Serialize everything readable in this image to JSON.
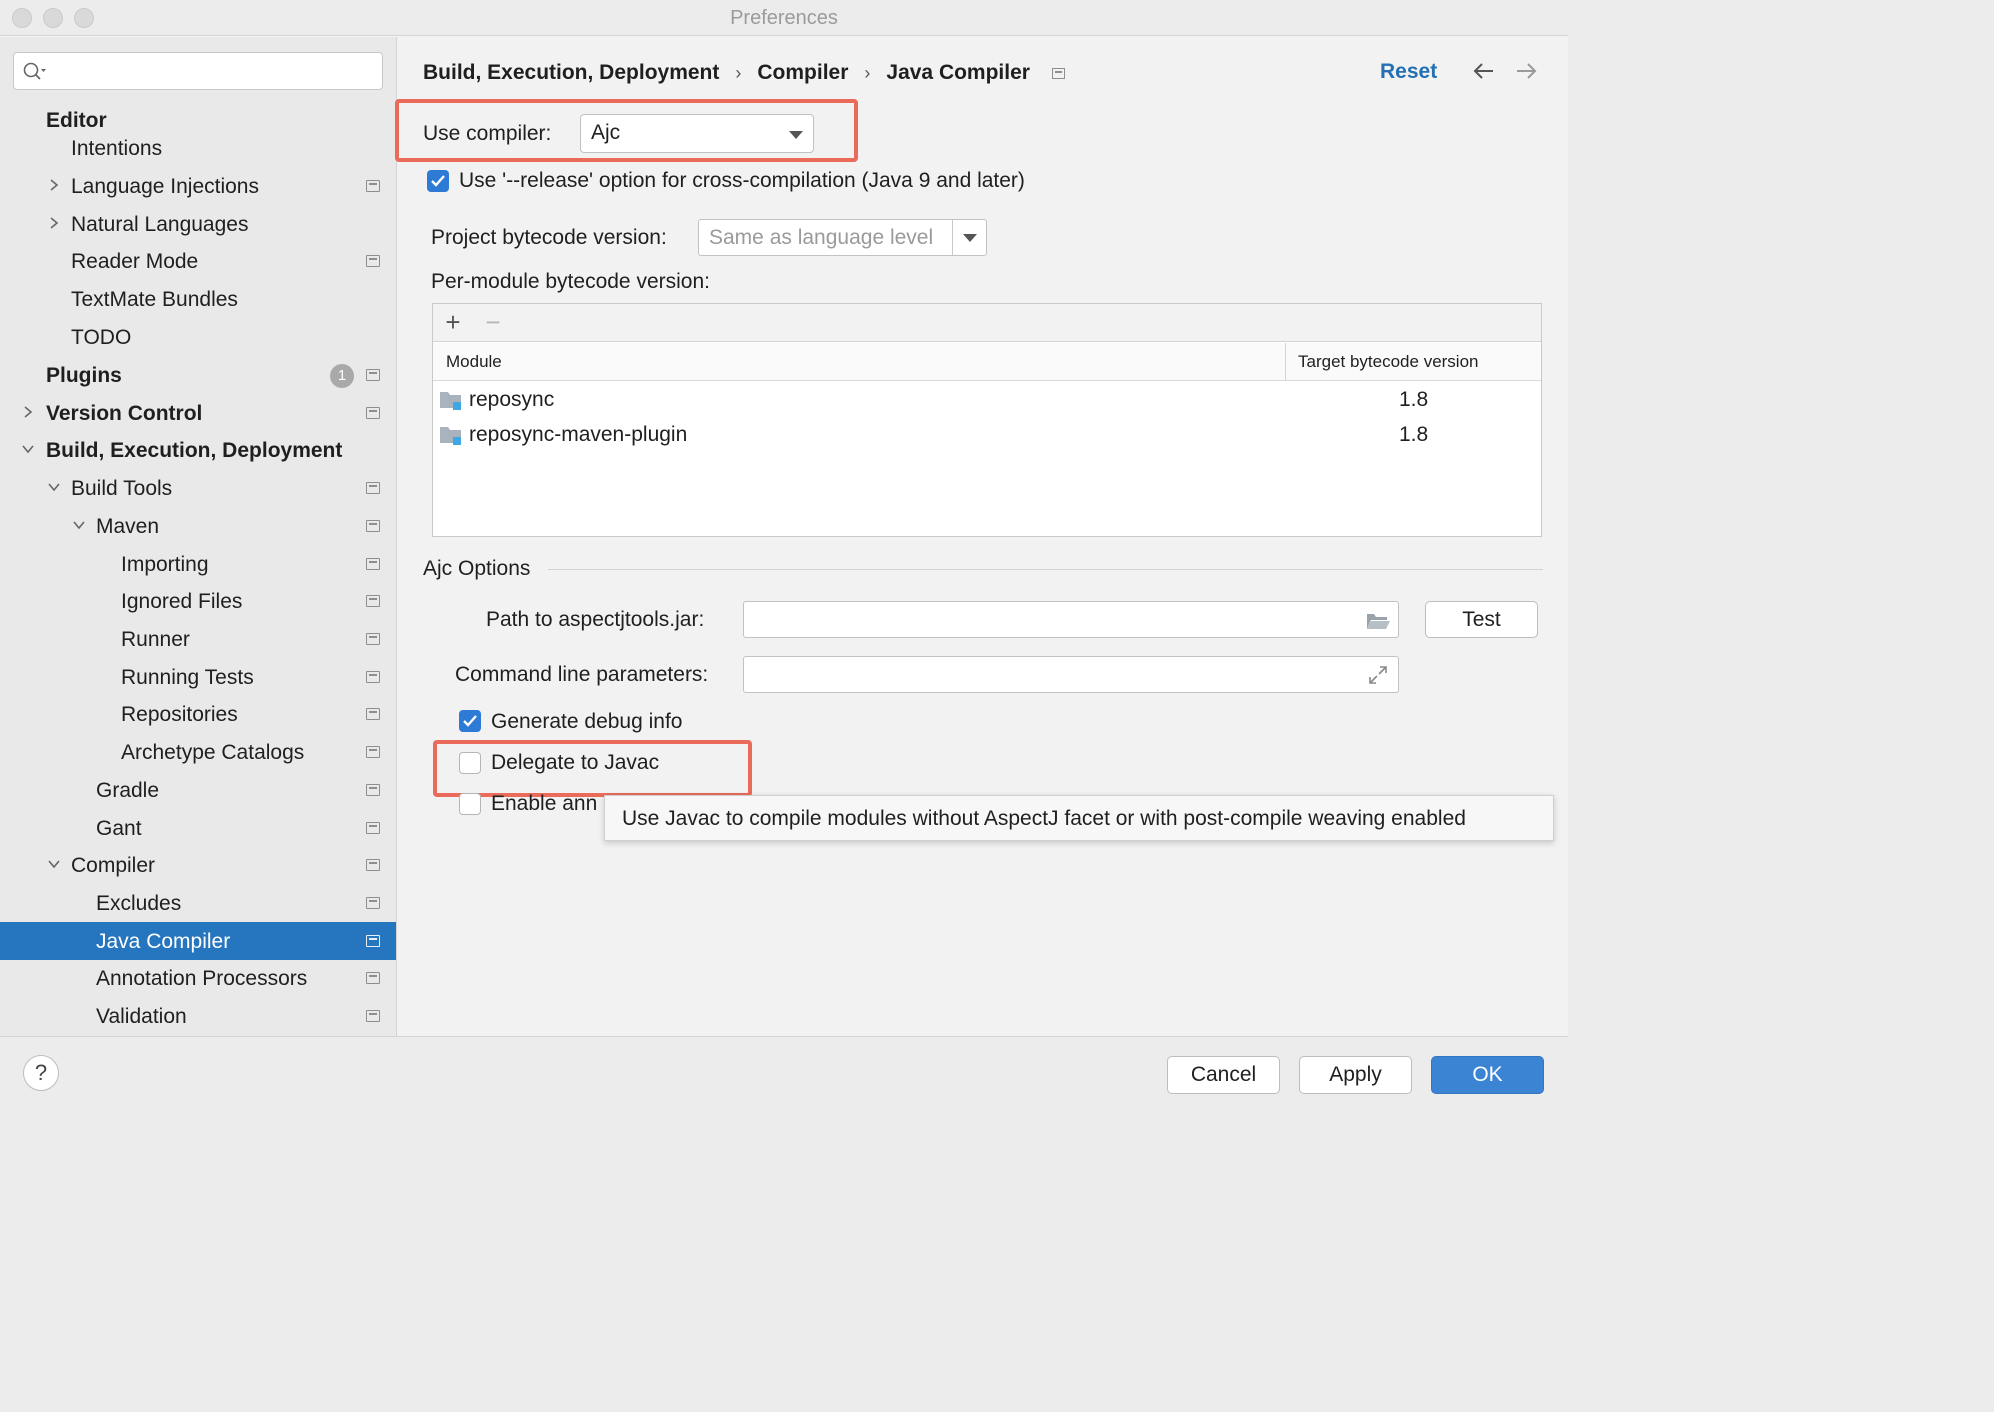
{
  "window": {
    "title": "Preferences"
  },
  "sidebar": {
    "search": {
      "placeholder": "",
      "value": ""
    },
    "items": [
      {
        "label": "Editor",
        "bold": true
      },
      {
        "label": "Intentions"
      },
      {
        "label": "Language Injections"
      },
      {
        "label": "Natural Languages"
      },
      {
        "label": "Reader Mode"
      },
      {
        "label": "TextMate Bundles"
      },
      {
        "label": "TODO"
      },
      {
        "label": "Plugins",
        "bold": true,
        "badge": "1"
      },
      {
        "label": "Version Control",
        "bold": true
      },
      {
        "label": "Build, Execution, Deployment",
        "bold": true
      },
      {
        "label": "Build Tools"
      },
      {
        "label": "Maven"
      },
      {
        "label": "Importing"
      },
      {
        "label": "Ignored Files"
      },
      {
        "label": "Runner"
      },
      {
        "label": "Running Tests"
      },
      {
        "label": "Repositories"
      },
      {
        "label": "Archetype Catalogs"
      },
      {
        "label": "Gradle"
      },
      {
        "label": "Gant"
      },
      {
        "label": "Compiler"
      },
      {
        "label": "Excludes"
      },
      {
        "label": "Java Compiler",
        "selected": true
      },
      {
        "label": "Annotation Processors"
      },
      {
        "label": "Validation"
      }
    ]
  },
  "header": {
    "breadcrumb": [
      "Build, Execution, Deployment",
      "Compiler",
      "Java Compiler"
    ],
    "separator": "›",
    "reset_label": "Reset"
  },
  "compiler": {
    "use_compiler_label": "Use compiler:",
    "use_compiler_value": "Ajc",
    "release_option_label": "Use '--release' option for cross-compilation (Java 9 and later)",
    "release_option_checked": true,
    "bytecode_label": "Project bytecode version:",
    "bytecode_value": "Same as language level",
    "per_module_label": "Per-module bytecode version:",
    "table": {
      "add_label": "+",
      "remove_label": "−",
      "columns": [
        "Module",
        "Target bytecode version"
      ],
      "rows": [
        {
          "module": "reposync",
          "version": "1.8"
        },
        {
          "module": "reposync-maven-plugin",
          "version": "1.8"
        }
      ]
    }
  },
  "ajc": {
    "section_title": "Ajc Options",
    "path_label": "Path to aspectjtools.jar:",
    "path_value": "",
    "test_label": "Test",
    "cmd_label": "Command line parameters:",
    "cmd_value": "",
    "debug_label": "Generate debug info",
    "debug_checked": true,
    "delegate_label": "Delegate to Javac",
    "delegate_checked": false,
    "annotation_label_visible": "Enable ann",
    "annotation_checked": false,
    "tooltip": "Use Javac to compile modules without AspectJ facet or with post-compile weaving enabled"
  },
  "footer": {
    "help_label": "?",
    "cancel_label": "Cancel",
    "apply_label": "Apply",
    "ok_label": "OK"
  },
  "colors": {
    "accent": "#2675bf",
    "highlight": "#ea6b5a",
    "link": "#2470b3",
    "checkbox_checked": "#2e7bd6"
  },
  "icons": [
    "search-icon",
    "chevron-right-icon",
    "chevron-down-icon",
    "settings-page-icon",
    "back-arrow-icon",
    "forward-arrow-icon",
    "folder-icon",
    "module-folder-icon",
    "open-folder-icon",
    "expand-icon",
    "help-icon"
  ]
}
